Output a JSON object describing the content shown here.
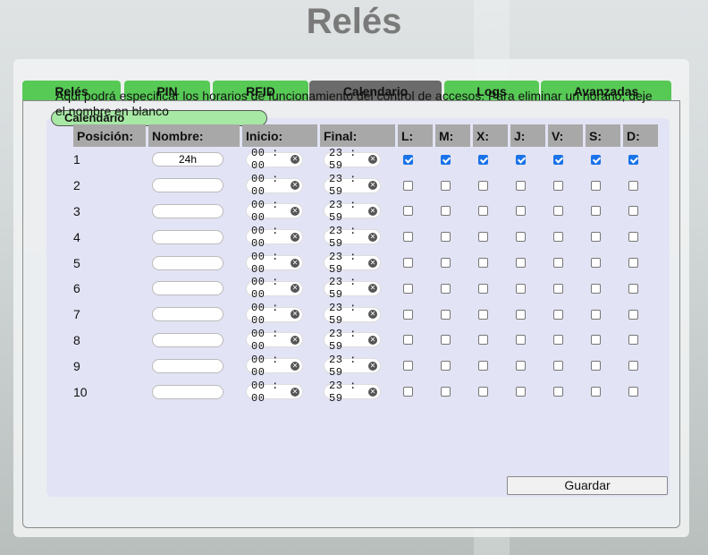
{
  "page": {
    "title": "Relés"
  },
  "tabs": [
    {
      "label": "Relés",
      "active": false
    },
    {
      "label": "PIN",
      "active": false
    },
    {
      "label": "RFID",
      "active": false
    },
    {
      "label": "Calendario",
      "active": true
    },
    {
      "label": "Logs",
      "active": false
    },
    {
      "label": "Avanzadas",
      "active": false
    }
  ],
  "section": {
    "label": "Calendario",
    "description": "Aqui podrá especificar los horarios de funcionamiento del control de accesos. Para eliminar un horario, deje el nombre en blanco"
  },
  "table": {
    "headers": [
      "Posición:",
      "Nombre:",
      "Inicio:",
      "Final:",
      "L:",
      "M:",
      "X:",
      "J:",
      "V:",
      "S:",
      "D:"
    ],
    "rows": [
      {
        "pos": "1",
        "name": "24h",
        "start": "00 : 00",
        "end": "23 : 59",
        "days": [
          true,
          true,
          true,
          true,
          true,
          true,
          true
        ]
      },
      {
        "pos": "2",
        "name": "",
        "start": "00 : 00",
        "end": "23 : 59",
        "days": [
          false,
          false,
          false,
          false,
          false,
          false,
          false
        ]
      },
      {
        "pos": "3",
        "name": "",
        "start": "00 : 00",
        "end": "23 : 59",
        "days": [
          false,
          false,
          false,
          false,
          false,
          false,
          false
        ]
      },
      {
        "pos": "4",
        "name": "",
        "start": "00 : 00",
        "end": "23 : 59",
        "days": [
          false,
          false,
          false,
          false,
          false,
          false,
          false
        ]
      },
      {
        "pos": "5",
        "name": "",
        "start": "00 : 00",
        "end": "23 : 59",
        "days": [
          false,
          false,
          false,
          false,
          false,
          false,
          false
        ]
      },
      {
        "pos": "6",
        "name": "",
        "start": "00 : 00",
        "end": "23 : 59",
        "days": [
          false,
          false,
          false,
          false,
          false,
          false,
          false
        ]
      },
      {
        "pos": "7",
        "name": "",
        "start": "00 : 00",
        "end": "23 : 59",
        "days": [
          false,
          false,
          false,
          false,
          false,
          false,
          false
        ]
      },
      {
        "pos": "8",
        "name": "",
        "start": "00 : 00",
        "end": "23 : 59",
        "days": [
          false,
          false,
          false,
          false,
          false,
          false,
          false
        ]
      },
      {
        "pos": "9",
        "name": "",
        "start": "00 : 00",
        "end": "23 : 59",
        "days": [
          false,
          false,
          false,
          false,
          false,
          false,
          false
        ]
      },
      {
        "pos": "10",
        "name": "",
        "start": "00 : 00",
        "end": "23 : 59",
        "days": [
          false,
          false,
          false,
          false,
          false,
          false,
          false
        ]
      }
    ]
  },
  "actions": {
    "save_label": "Guardar"
  },
  "colors": {
    "tab": "#57c955",
    "tab_active": "#6b6b6b",
    "section_tab": "#a6e8a4",
    "checkbox_on": "#1a73e8"
  },
  "icons": {
    "clear": "clear-icon"
  }
}
